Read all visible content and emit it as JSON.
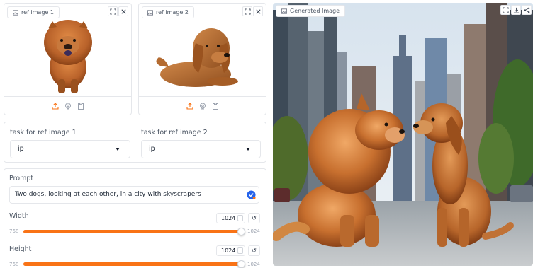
{
  "ref_images": [
    {
      "label": "ref image 1"
    },
    {
      "label": "ref image 2"
    }
  ],
  "tasks": [
    {
      "label": "task for ref image 1",
      "value": "ip"
    },
    {
      "label": "task for ref image 2",
      "value": "ip"
    }
  ],
  "prompt": {
    "label": "Prompt",
    "value": "Two dogs, looking at each other, in a city with skyscrapers"
  },
  "width": {
    "label": "Width",
    "value": "1024",
    "min": "768",
    "max": "1024",
    "fraction": 1.0
  },
  "height": {
    "label": "Height",
    "value": "1024",
    "min": "768",
    "max": "1024",
    "fraction": 1.0
  },
  "generated": {
    "label": "Generated Image"
  },
  "colors": {
    "accent": "#f97316",
    "check": "#2563eb"
  },
  "icons": [
    "fullscreen-icon",
    "close-icon",
    "upload-icon",
    "webcam-icon",
    "clipboard-icon",
    "image-icon",
    "download-icon",
    "share-icon",
    "reset-icon",
    "check-icon",
    "chevron-down-icon"
  ]
}
